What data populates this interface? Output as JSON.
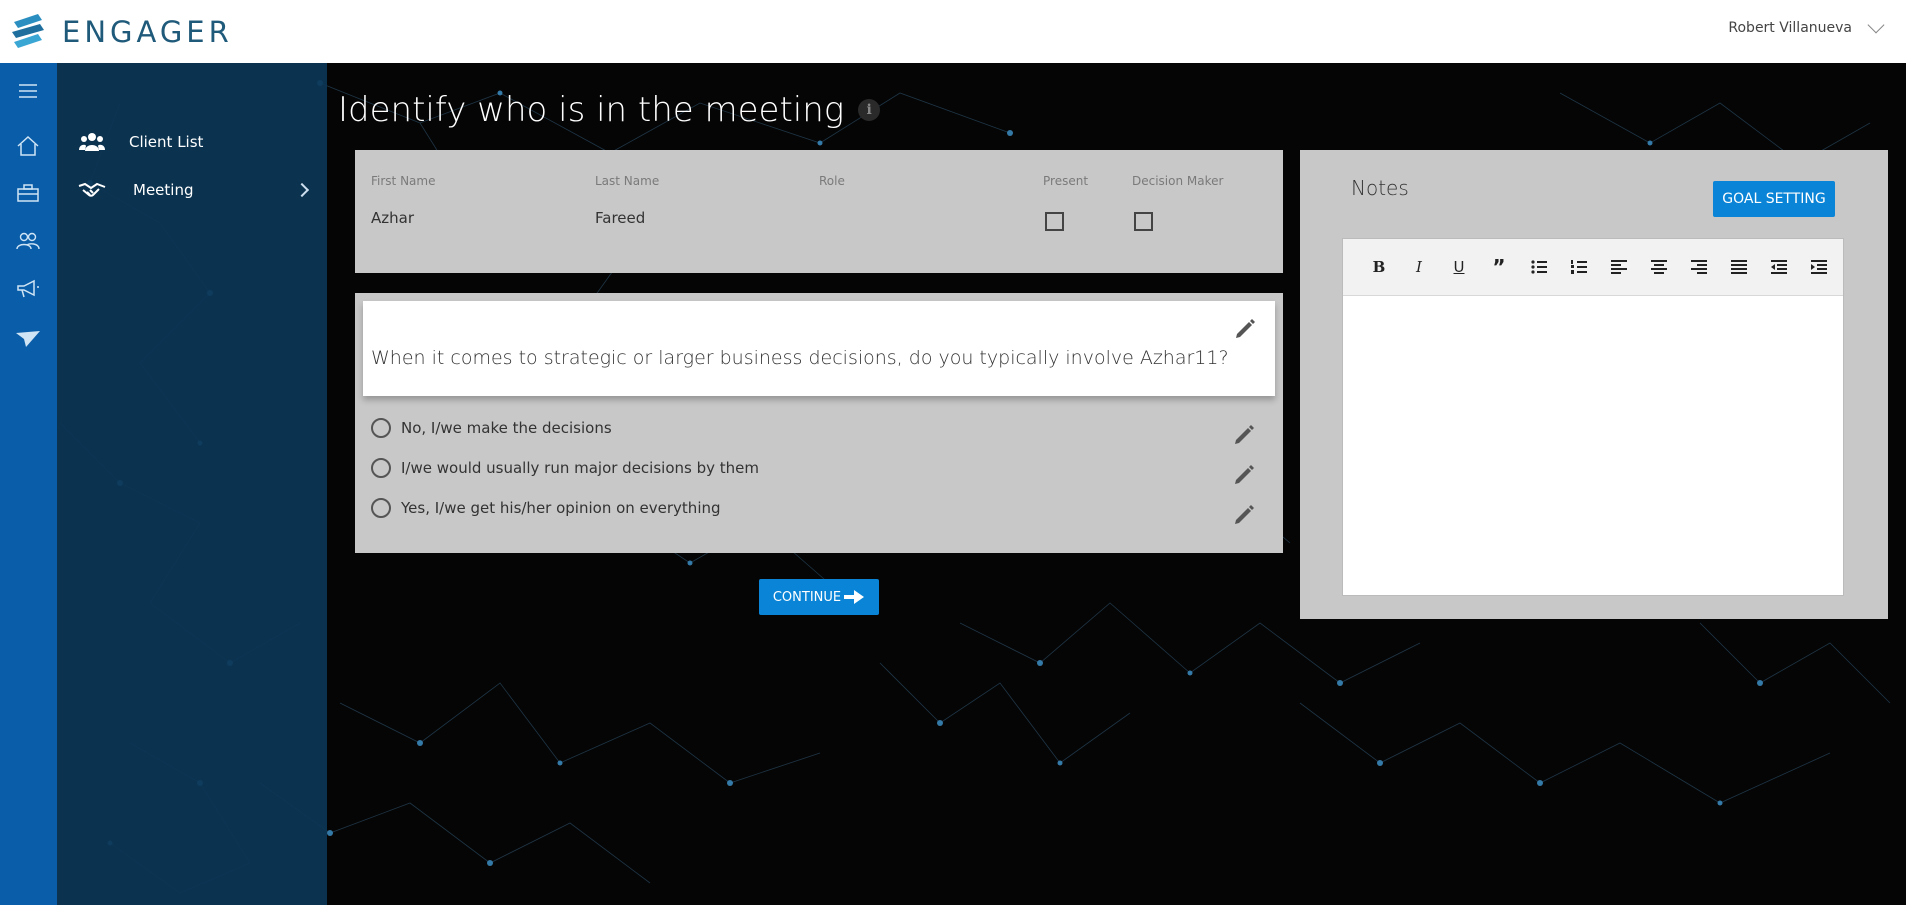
{
  "app": {
    "name": "ENGAGER",
    "user_name": "Robert Villanueva"
  },
  "sidebar": {
    "items": [
      {
        "label": "Client List",
        "icon": "users-icon"
      },
      {
        "label": "Meeting",
        "icon": "handshake-icon"
      }
    ]
  },
  "rail": {
    "icons": [
      "menu-icon",
      "home-icon",
      "briefcase-icon",
      "people-icon",
      "megaphone-icon",
      "paper-plane-icon"
    ]
  },
  "page": {
    "title": "Identify who is in the meeting"
  },
  "people": {
    "headers": {
      "first_name": "First Name",
      "last_name": "Last Name",
      "role": "Role",
      "present": "Present",
      "decision_maker": "Decision Maker"
    },
    "rows": [
      {
        "first_name": "Azhar",
        "last_name": "Fareed",
        "role": "",
        "present": false,
        "decision_maker": false
      }
    ]
  },
  "question": {
    "text": "When it comes to strategic or larger business decisions, do you typically involve Azhar11?",
    "options": [
      "No, I/we make the decisions",
      "I/we would usually run major decisions by them",
      "Yes, I/we get his/her opinion on everything"
    ]
  },
  "actions": {
    "continue_label": "CONTINUE"
  },
  "notes": {
    "title": "Notes",
    "goal_setting_label": "GOAL SETTING",
    "content": ""
  },
  "colors": {
    "primary": "#0a84d6",
    "rail": "#0a5da8",
    "subnav": "#0c3656",
    "panel": "#c8c8c8"
  }
}
